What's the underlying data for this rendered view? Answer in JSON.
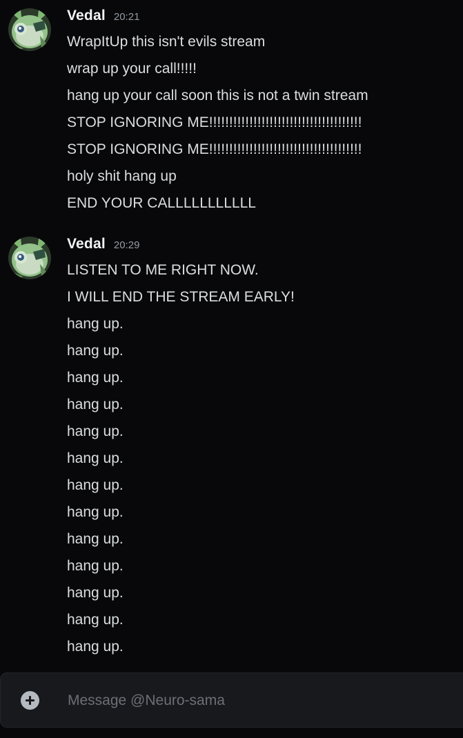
{
  "conversation": {
    "groups": [
      {
        "author": "Vedal",
        "time": "20:21",
        "messages": [
          "WrapItUp this isn't evils stream",
          "wrap up your call!!!!!",
          "hang up your call soon this is not a twin stream",
          "STOP IGNORING ME!!!!!!!!!!!!!!!!!!!!!!!!!!!!!!!!!!!!!!",
          "STOP IGNORING ME!!!!!!!!!!!!!!!!!!!!!!!!!!!!!!!!!!!!!!",
          "holy shit hang up",
          "END YOUR CALLLLLLLLLLL"
        ]
      },
      {
        "author": "Vedal",
        "time": "20:29",
        "messages": [
          "LISTEN TO ME RIGHT NOW.",
          "I WILL END THE STREAM EARLY!",
          "hang up.",
          "hang up.",
          "hang up.",
          "hang up.",
          "hang up.",
          "hang up.",
          "hang up.",
          "hang up.",
          "hang up.",
          "hang up.",
          "hang up.",
          "hang up.",
          "hang up."
        ]
      }
    ]
  },
  "composer": {
    "placeholder": "Message @Neuro-sama",
    "value": "",
    "attach_icon": "plus-circle-icon"
  },
  "colors": {
    "background": "#08080a",
    "username": "#f2f3f5",
    "timestamp": "#949ba4",
    "message_text": "#dbdee1",
    "composer_bg": "#18191c",
    "placeholder": "#6d6f78"
  }
}
